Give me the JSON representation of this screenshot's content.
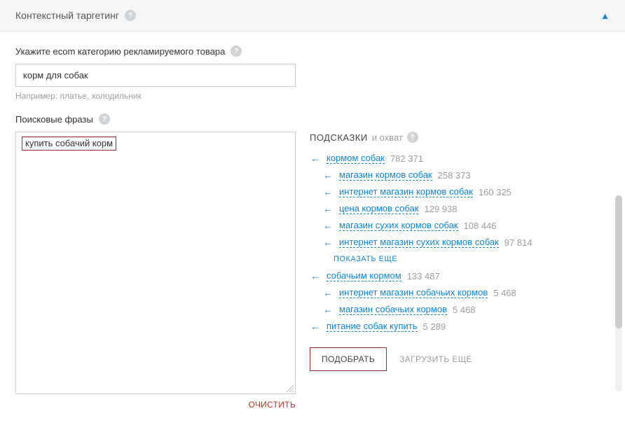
{
  "header": {
    "title": "Контекстный таргетинг"
  },
  "category": {
    "label": "Укажите ecom категорию рекламируемого товара",
    "value": "корм для собак",
    "hint": "Например: платье, холодильник"
  },
  "phrases": {
    "label": "Поисковые фразы",
    "value": "купить собачий корм",
    "clear": "ОЧИСТИТЬ"
  },
  "hints": {
    "title": "ПОДСКАЗКИ",
    "subtitle": "и охват",
    "items": [
      {
        "level": 0,
        "text": "кормом собак",
        "count": "782 371"
      },
      {
        "level": 1,
        "text": "магазин кормов собак",
        "count": "258 373"
      },
      {
        "level": 1,
        "text": "интернет магазин кормов собак",
        "count": "160 325"
      },
      {
        "level": 1,
        "text": "цена кормов собак",
        "count": "129 938"
      },
      {
        "level": 1,
        "text": "магазин сухих кормов собак",
        "count": "108 446"
      },
      {
        "level": 1,
        "text": "интернет магазин сухих кормов собак",
        "count": "97 814"
      }
    ],
    "show_more": "ПОКАЗАТЬ ЕЩЕ",
    "items2": [
      {
        "level": 0,
        "text": "собачьим кормом",
        "count": "133 487"
      },
      {
        "level": 1,
        "text": "интернет магазин собачьих кормов",
        "count": "5 468"
      },
      {
        "level": 1,
        "text": "магазин собачьих кормов",
        "count": "5 468"
      },
      {
        "level": 0,
        "text": "питание собак купить",
        "count": "5 289"
      }
    ],
    "pick_button": "ПОДОБРАТЬ",
    "load_more": "ЗАГРУЗИТЬ ЕЩЕ"
  }
}
